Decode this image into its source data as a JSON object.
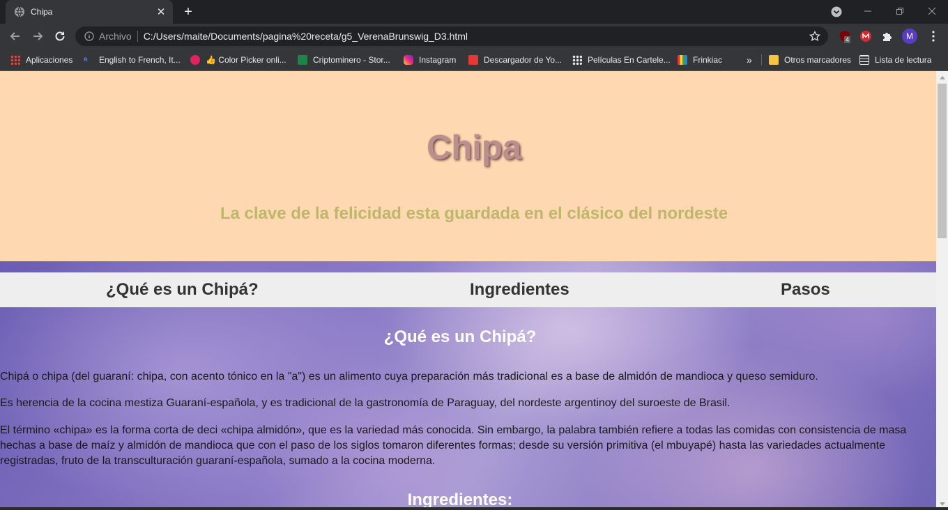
{
  "browser": {
    "tab_title": "Chipa",
    "address_scheme": "Archivo",
    "address_url": "C:/Users/maite/Documents/pagina%20receta/g5_VerenaBrunswig_D3.html",
    "ext_badge": "4",
    "profile_initial": "M",
    "bookmarks": [
      {
        "label": "Aplicaciones",
        "icon": "apps-grid-icon"
      },
      {
        "label": "English to French, It...",
        "icon": "reverso-icon"
      },
      {
        "label": "Color Picker onli...",
        "icon": "color-picker-icon"
      },
      {
        "label": "👍 Color Picker onli...",
        "icon": "thumbs-up-icon"
      },
      {
        "label": "Criptominero - Stor...",
        "icon": "criptominero-icon"
      },
      {
        "label": "Instagram",
        "icon": "instagram-icon"
      },
      {
        "label": "Descargador de Yo...",
        "icon": "download-icon"
      },
      {
        "label": "Películas En Cartele...",
        "icon": "dots-icon"
      },
      {
        "label": "Frinkiac",
        "icon": "frinkiac-icon"
      }
    ],
    "overflow_label": "»",
    "other_bookmarks": "Otros marcadores",
    "reading_list": "Lista de lectura"
  },
  "page": {
    "title": "Chipa",
    "subtitle": "La clave de la felicidad esta guardada en el clásico del nordeste",
    "nav": [
      "¿Qué es un Chipá?",
      "Ingredientes",
      "Pasos"
    ],
    "section1_title": "¿Qué es un Chipá?",
    "section1_paragraphs": [
      "Chipá o chipa (del guaraní: chipa, con acento tónico en la \"a\") es un alimento cuya preparación más tradicional es a base de almidón de mandioca y queso semiduro.",
      "Es herencia de la cocina mestiza Guaraní-española, y es tradicional de la gastronomía de Paraguay, del nordeste argentinoy del suroeste de Brasil.",
      "El término «chipa» es la forma corta de deci «chipa almidón», que es la variedad más conocida. Sin embargo, la palabra también refiere a todas las comidas con consistencia de masa hechas a base de maíz y almidón de mandioca que con el paso de los siglos tomaron diferentes formas; desde su versión primitiva (el mbuyapé) hasta las variedades actualmente registradas, fruto de la transculturación guaraní-española, sumado a la cocina moderna."
    ],
    "section2_title": "Ingredientes:"
  },
  "colors": {
    "hero_bg": "#fed8b1",
    "title": "#bc8f8f",
    "subtitle": "#bdb76b",
    "navbar_bg": "#eeeeee"
  }
}
